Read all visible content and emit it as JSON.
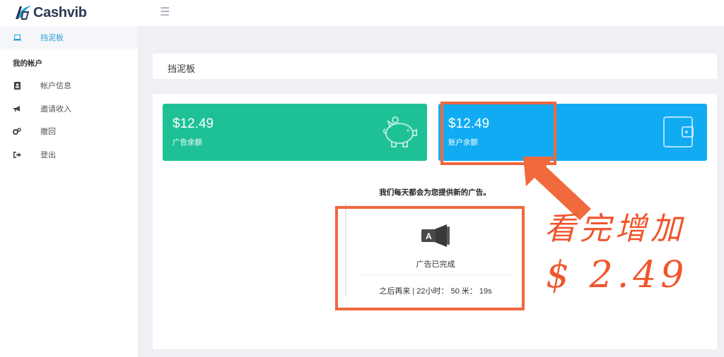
{
  "app": {
    "logo_text": "Cashvib",
    "logo_icon": "cashvib-logo-icon",
    "menu_icon": "hamburger-icon"
  },
  "sidebar": {
    "dashboard": {
      "label": "挡泥板",
      "icon": "laptop-icon"
    },
    "section_heading": "我的帐户",
    "items": [
      {
        "label": "帐户信息",
        "icon": "contact-card-icon"
      },
      {
        "label": "邀请收入",
        "icon": "megaphone-icon"
      },
      {
        "label": "撤回",
        "icon": "gears-icon"
      },
      {
        "label": "登出",
        "icon": "sign-out-icon"
      }
    ]
  },
  "page": {
    "title": "挡泥板"
  },
  "stats": {
    "ad_balance": {
      "value": "$12.49",
      "caption": "广告余额",
      "icon": "piggy-bank-icon",
      "color": "#1dc195"
    },
    "account_balance": {
      "value": "$12.49",
      "caption": "账户余额",
      "icon": "wallet-icon",
      "color": "#10abf3"
    }
  },
  "notice": "我们每天都会为您提供新的广告。",
  "ad": {
    "icon": "ad-megaphone-icon",
    "status": "广告已完成",
    "timer": "之后再来 | 22小时： 50 米： 19s"
  },
  "annotation": {
    "color": "#f0693c",
    "line1": "看完增加",
    "line2": "$ 2.49"
  }
}
